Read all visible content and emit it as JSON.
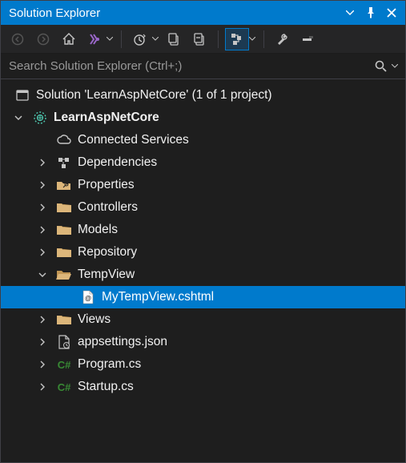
{
  "titlebar": {
    "title": "Solution Explorer"
  },
  "search": {
    "placeholder": "Search Solution Explorer (Ctrl+;)"
  },
  "tree": {
    "solution_label": "Solution 'LearnAspNetCore' (1 of 1 project)",
    "project_label": "LearnAspNetCore",
    "connected_services": "Connected Services",
    "dependencies": "Dependencies",
    "properties": "Properties",
    "controllers": "Controllers",
    "models": "Models",
    "repository": "Repository",
    "tempview": "TempView",
    "mytempview": "MyTempView.cshtml",
    "views": "Views",
    "appsettings": "appsettings.json",
    "program": "Program.cs",
    "startup": "Startup.cs"
  },
  "colors": {
    "accent": "#007acc",
    "folder": "#dcb67a",
    "cs_green": "#388a34",
    "purple": "#68217a"
  }
}
